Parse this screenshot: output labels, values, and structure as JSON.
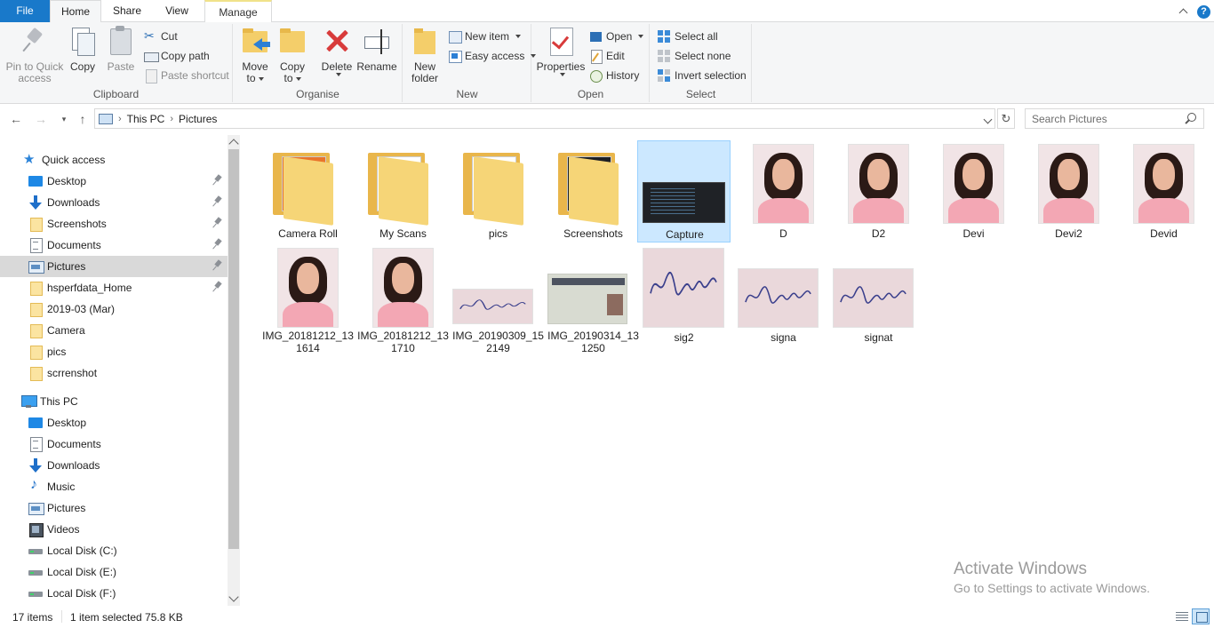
{
  "tabs": {
    "file": "File",
    "home": "Home",
    "share": "Share",
    "view": "View",
    "manage": "Manage",
    "help": "?"
  },
  "ribbon": {
    "clipboard": {
      "label": "Clipboard",
      "pin": [
        "Pin to Quick",
        "access"
      ],
      "copy": "Copy",
      "paste": "Paste",
      "cut": "Cut",
      "copy_path": "Copy path",
      "paste_shortcut": "Paste shortcut"
    },
    "organise": {
      "label": "Organise",
      "move_to": [
        "Move",
        "to"
      ],
      "copy_to": [
        "Copy",
        "to"
      ],
      "delete": "Delete",
      "rename": "Rename"
    },
    "new": {
      "label": "New",
      "new_folder": [
        "New",
        "folder"
      ],
      "new_item": "New item",
      "easy_access": "Easy access"
    },
    "open": {
      "label": "Open",
      "properties": "Properties",
      "open": "Open",
      "edit": "Edit",
      "history": "History"
    },
    "select": {
      "label": "Select",
      "select_all": "Select all",
      "select_none": "Select none",
      "invert": "Invert selection"
    }
  },
  "address": {
    "breadcrumb": [
      "This PC",
      "Pictures"
    ],
    "search_placeholder": "Search Pictures"
  },
  "sidebar": {
    "quick_access": "Quick access",
    "quick_items": [
      {
        "label": "Desktop",
        "icon": "desktop-icon",
        "pinned": true
      },
      {
        "label": "Downloads",
        "icon": "downloads-icon",
        "pinned": true
      },
      {
        "label": "Screenshots",
        "icon": "folder-icon",
        "pinned": true
      },
      {
        "label": "Documents",
        "icon": "documents-icon",
        "pinned": true
      },
      {
        "label": "Pictures",
        "icon": "pictures-icon",
        "pinned": true,
        "selected": true
      },
      {
        "label": "hsperfdata_Home",
        "icon": "folder-icon",
        "pinned": true
      },
      {
        "label": "2019-03 (Mar)",
        "icon": "folder-icon",
        "pinned": false
      },
      {
        "label": "Camera",
        "icon": "folder-icon",
        "pinned": false
      },
      {
        "label": "pics",
        "icon": "folder-icon",
        "pinned": false
      },
      {
        "label": "scrrenshot",
        "icon": "folder-icon",
        "pinned": false
      }
    ],
    "this_pc": "This PC",
    "pc_items": [
      {
        "label": "Desktop",
        "icon": "desktop-icon"
      },
      {
        "label": "Documents",
        "icon": "documents-icon"
      },
      {
        "label": "Downloads",
        "icon": "downloads-icon"
      },
      {
        "label": "Music",
        "icon": "music-icon"
      },
      {
        "label": "Pictures",
        "icon": "pictures-icon"
      },
      {
        "label": "Videos",
        "icon": "videos-icon"
      },
      {
        "label": "Local Disk (C:)",
        "icon": "disk-icon"
      },
      {
        "label": "Local Disk (E:)",
        "icon": "disk-icon"
      },
      {
        "label": "Local Disk (F:)",
        "icon": "disk-icon"
      }
    ]
  },
  "files": [
    {
      "name": "Camera Roll",
      "kind": "folder"
    },
    {
      "name": "My Scans",
      "kind": "folder"
    },
    {
      "name": "pics",
      "kind": "folder"
    },
    {
      "name": "Screenshots",
      "kind": "folder"
    },
    {
      "name": "Capture",
      "kind": "screenshot",
      "selected": true
    },
    {
      "name": "D",
      "kind": "photo"
    },
    {
      "name": "D2",
      "kind": "photo"
    },
    {
      "name": "Devi",
      "kind": "photo"
    },
    {
      "name": "Devi2",
      "kind": "photo"
    },
    {
      "name": "Devid",
      "kind": "photo"
    },
    {
      "name": "IMG_20181212_131614",
      "kind": "photo"
    },
    {
      "name": "IMG_20181212_131710",
      "kind": "photo"
    },
    {
      "name": "IMG_20190309_152149",
      "kind": "signature-wide"
    },
    {
      "name": "IMG_20190314_131250",
      "kind": "card"
    },
    {
      "name": "sig2",
      "kind": "signature"
    },
    {
      "name": "signa",
      "kind": "signature"
    },
    {
      "name": "signat",
      "kind": "signature"
    }
  ],
  "watermark": {
    "title": "Activate Windows",
    "subtitle": "Go to Settings to activate Windows."
  },
  "status": {
    "count": "17 items",
    "selection": "1 item selected  75.8 KB"
  }
}
